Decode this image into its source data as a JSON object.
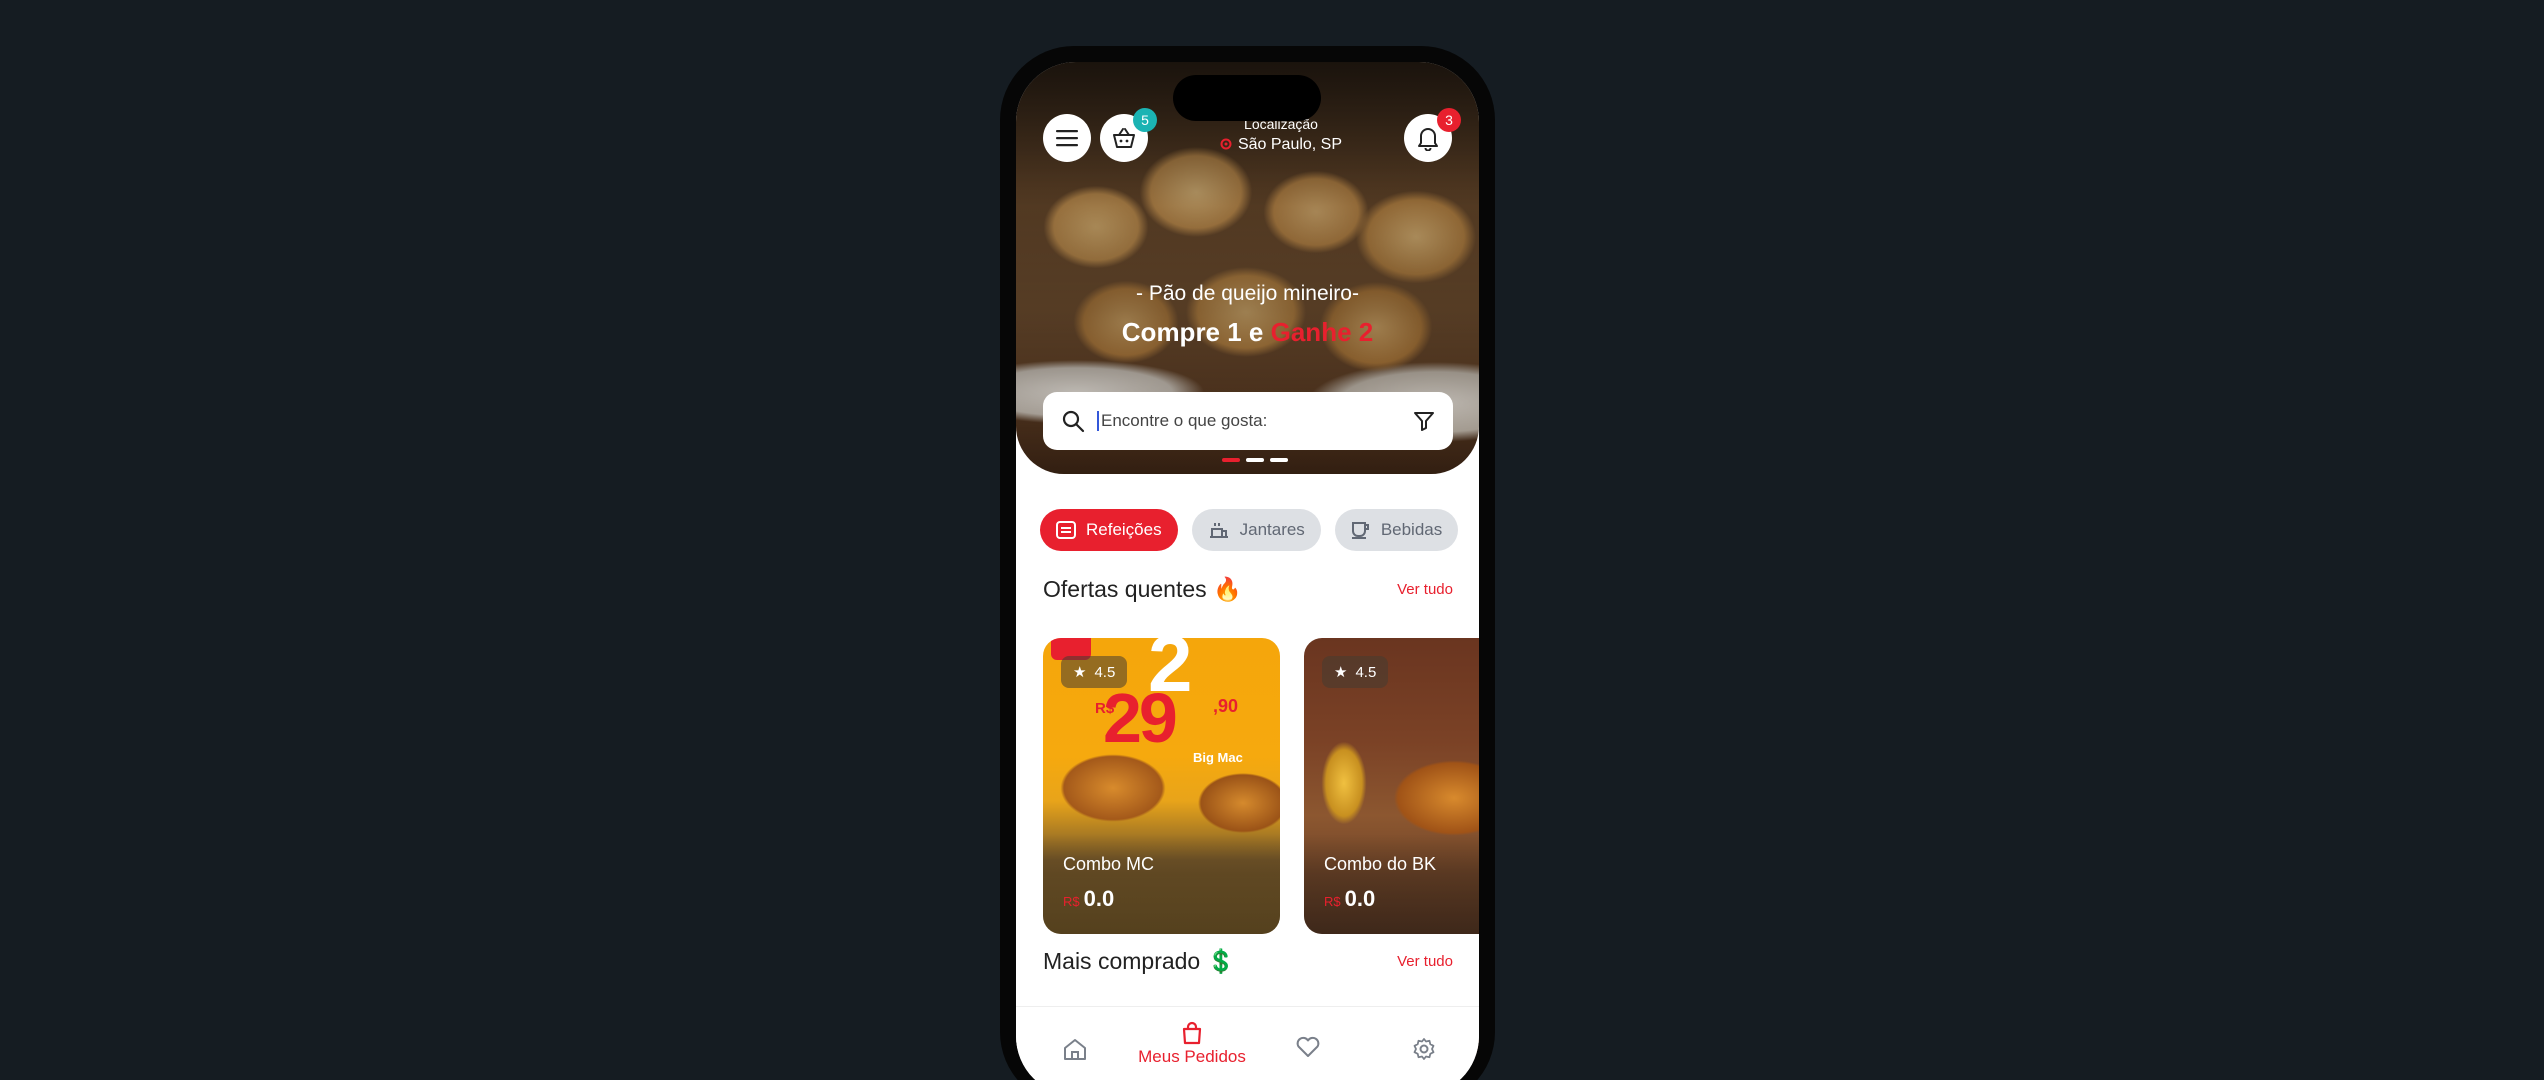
{
  "header": {
    "menu_icon": "hamburger-menu-icon",
    "cart_icon": "basket-icon",
    "cart_count": "5",
    "cart_badge_color": "#1bb3b3",
    "location_label": "Localização",
    "location_city": "São Paulo, SP",
    "notification_icon": "bell-icon",
    "notification_count": "3",
    "notification_badge_color": "#e8202e"
  },
  "hero": {
    "subtitle": "- Pão de queijo mineiro-",
    "title_prefix": "Compre 1 e",
    "title_highlight": "Ganhe 2",
    "slides_count": 3,
    "active_slide": 0
  },
  "search": {
    "placeholder": "Encontre o que gosta:",
    "value": "",
    "search_icon": "search-icon",
    "filter_icon": "filter-icon"
  },
  "categories": [
    {
      "label": "Refeições",
      "icon": "meal-icon",
      "active": true
    },
    {
      "label": "Jantares",
      "icon": "dinner-icon",
      "active": false
    },
    {
      "label": "Bebidas",
      "icon": "coffee-cup-icon",
      "active": false
    }
  ],
  "offers": {
    "title": "Ofertas quentes 🔥",
    "link": "Ver tudo",
    "items": [
      {
        "name": "Combo MC",
        "rating": "4.5",
        "currency": "R$",
        "price": "0.0",
        "ad_price_prefix": "R$",
        "ad_price": "29",
        "ad_cents": ",90",
        "ad_top": "2",
        "ad_caption": "Big Mac"
      },
      {
        "name": "Combo do BK",
        "rating": "4.5",
        "currency": "R$",
        "price": "0.0"
      }
    ]
  },
  "most_bought": {
    "title": "Mais comprado 💲",
    "link": "Ver tudo"
  },
  "bottom_nav": [
    {
      "icon": "home-icon",
      "label": ""
    },
    {
      "icon": "shopping-bag-icon",
      "label": "Meus Pedidos",
      "active": true
    },
    {
      "icon": "heart-icon",
      "label": ""
    },
    {
      "icon": "gear-icon",
      "label": ""
    }
  ],
  "colors": {
    "accent": "#e8202e",
    "background": "#151c22",
    "chip_inactive": "#dde0e4"
  }
}
